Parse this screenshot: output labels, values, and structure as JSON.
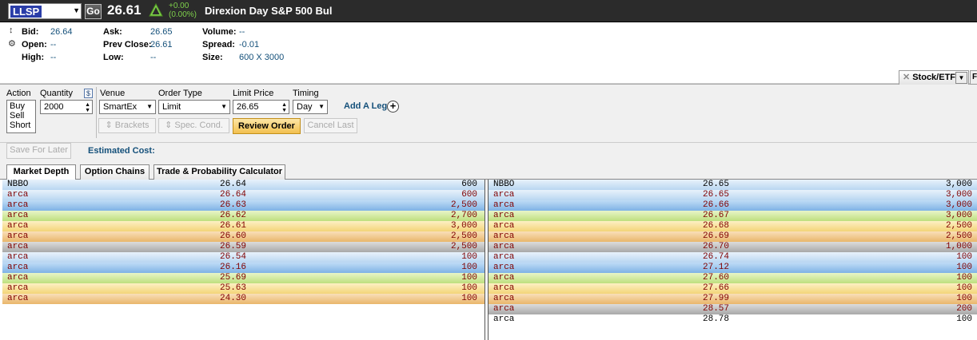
{
  "header": {
    "symbol": "LLSP",
    "go_label": "Go",
    "last_price": "26.61",
    "change_abs": "+0.00",
    "change_pct": "(0.00%)",
    "company_name": "Direxion Day S&P 500 Bul"
  },
  "quote": {
    "bid_label": "Bid:",
    "bid": "26.64",
    "open_label": "Open:",
    "open": "--",
    "high_label": "High:",
    "high": "--",
    "ask_label": "Ask:",
    "ask": "26.65",
    "prev_close_label": "Prev Close:",
    "prev_close": "26.61",
    "low_label": "Low:",
    "low": "--",
    "volume_label": "Volume:",
    "volume": "--",
    "spread_label": "Spread:",
    "spread": "-0.01",
    "size_label": "Size:",
    "size": "600 X 3000"
  },
  "order_tab": {
    "label": "Stock/ETF"
  },
  "order": {
    "action_label": "Action",
    "actions": [
      "Buy",
      "Sell",
      "Short"
    ],
    "quantity_label": "Quantity",
    "quantity": "2000",
    "dollar_label": "$",
    "venue_label": "Venue",
    "venue": "SmartEx",
    "order_type_label": "Order Type",
    "order_type": "Limit",
    "limit_price_label": "Limit Price",
    "limit_price": "26.65",
    "timing_label": "Timing",
    "timing": "Day",
    "add_leg_label": "Add A Leg",
    "brackets_label": "Brackets",
    "spec_cond_label": "Spec. Cond.",
    "review_label": "Review Order",
    "cancel_last_label": "Cancel Last",
    "save_later_label": "Save For Later",
    "estimated_cost_label": "Estimated Cost:"
  },
  "tabs": [
    "Market Depth",
    "Option Chains",
    "Trade & Probability Calculator"
  ],
  "depth": {
    "bids": [
      {
        "exchange": "NBBO",
        "price": "26.64",
        "size": "600"
      },
      {
        "exchange": "arca",
        "price": "26.64",
        "size": "600"
      },
      {
        "exchange": "arca",
        "price": "26.63",
        "size": "2,500"
      },
      {
        "exchange": "arca",
        "price": "26.62",
        "size": "2,700"
      },
      {
        "exchange": "arca",
        "price": "26.61",
        "size": "3,000"
      },
      {
        "exchange": "arca",
        "price": "26.60",
        "size": "2,500"
      },
      {
        "exchange": "arca",
        "price": "26.59",
        "size": "2,500"
      },
      {
        "exchange": "arca",
        "price": "26.54",
        "size": "100"
      },
      {
        "exchange": "arca",
        "price": "26.16",
        "size": "100"
      },
      {
        "exchange": "arca",
        "price": "25.69",
        "size": "100"
      },
      {
        "exchange": "arca",
        "price": "25.63",
        "size": "100"
      },
      {
        "exchange": "arca",
        "price": "24.30",
        "size": "100"
      }
    ],
    "asks": [
      {
        "exchange": "NBBO",
        "price": "26.65",
        "size": "3,000"
      },
      {
        "exchange": "arca",
        "price": "26.65",
        "size": "3,000"
      },
      {
        "exchange": "arca",
        "price": "26.66",
        "size": "3,000"
      },
      {
        "exchange": "arca",
        "price": "26.67",
        "size": "3,000"
      },
      {
        "exchange": "arca",
        "price": "26.68",
        "size": "2,500"
      },
      {
        "exchange": "arca",
        "price": "26.69",
        "size": "2,500"
      },
      {
        "exchange": "arca",
        "price": "26.70",
        "size": "1,000"
      },
      {
        "exchange": "arca",
        "price": "26.74",
        "size": "100"
      },
      {
        "exchange": "arca",
        "price": "27.12",
        "size": "100"
      },
      {
        "exchange": "arca",
        "price": "27.60",
        "size": "100"
      },
      {
        "exchange": "arca",
        "price": "27.66",
        "size": "100"
      },
      {
        "exchange": "arca",
        "price": "27.99",
        "size": "100"
      },
      {
        "exchange": "arca",
        "price": "28.57",
        "size": "200"
      },
      {
        "exchange": "arca",
        "price": "28.78",
        "size": "100"
      }
    ]
  }
}
